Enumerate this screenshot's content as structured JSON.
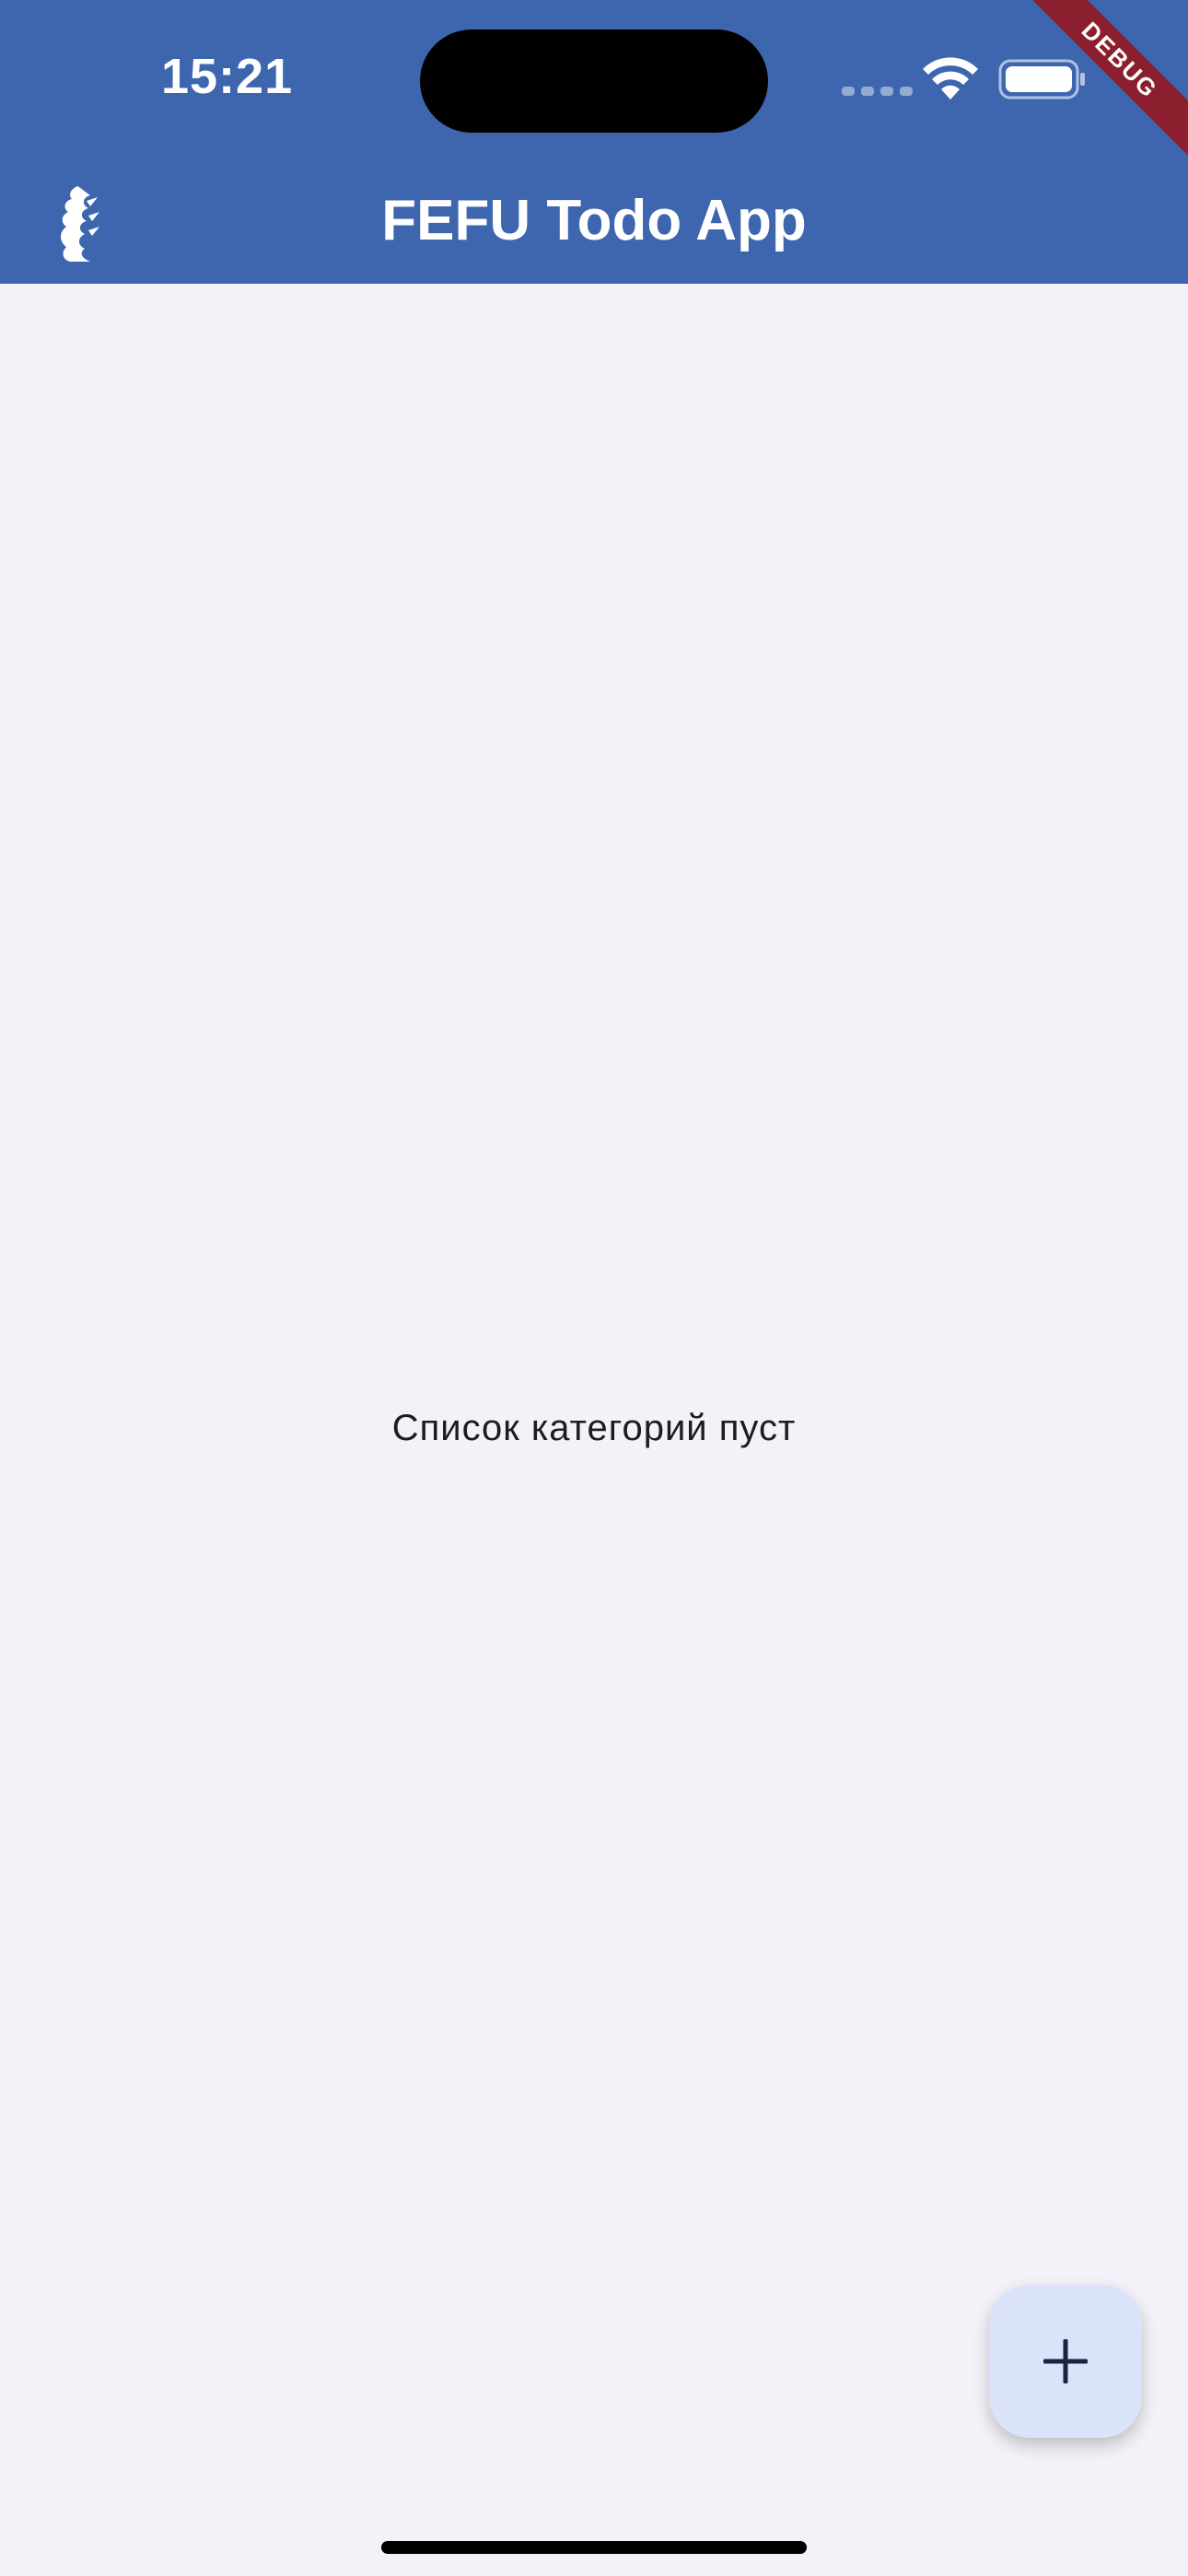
{
  "status_bar": {
    "time": "15:21",
    "icons": [
      "cellular-signal-icon",
      "wifi-icon",
      "battery-icon"
    ]
  },
  "debug_banner": {
    "label": "DEBUG",
    "color": "#8c1f2d"
  },
  "app_bar": {
    "title": "FEFU Todo App",
    "logo": "fefu-logo-icon",
    "background": "#3d66ae"
  },
  "main": {
    "empty_message": "Список категорий пуст",
    "background": "#f2f2f8"
  },
  "fab": {
    "icon": "plus-icon",
    "background": "#dbe3fb"
  }
}
